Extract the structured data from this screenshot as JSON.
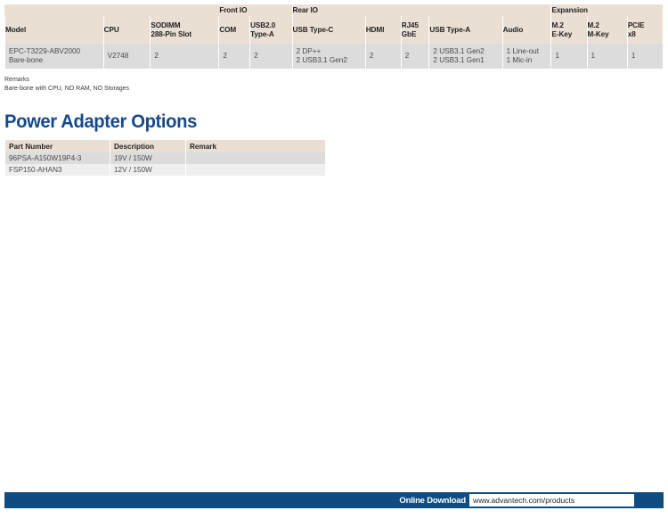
{
  "spec_table": {
    "groups": [
      {
        "label": "",
        "span": 3,
        "blank": true
      },
      {
        "label": "Front IO",
        "span": 2,
        "blank": false
      },
      {
        "label": "Rear IO",
        "span": 5,
        "blank": false
      },
      {
        "label": "Expansion",
        "span": 3,
        "blank": false
      }
    ],
    "columns": [
      {
        "label": "Model",
        "width": 105
      },
      {
        "label": "CPU",
        "width": 50
      },
      {
        "label": "SODIMM\n288-Pin Slot",
        "line1": "SODIMM",
        "line2": "288-Pin Slot",
        "width": 73
      },
      {
        "label": "COM",
        "width": 33
      },
      {
        "label": "USB2.0\nType-A",
        "line1": "USB2.0",
        "line2": "Type-A",
        "width": 45
      },
      {
        "label": "USB Type-C",
        "width": 78
      },
      {
        "label": "HDMI",
        "width": 38
      },
      {
        "label": "RJ45\nGbE",
        "line1": "RJ45",
        "line2": "GbE",
        "width": 30
      },
      {
        "label": "USB Type-A",
        "width": 78
      },
      {
        "label": "Audio",
        "width": 52
      },
      {
        "label": "M.2\nE-Key",
        "line1": "M.2",
        "line2": "E-Key",
        "width": 38
      },
      {
        "label": "M.2\nM-Key",
        "line1": "M.2",
        "line2": "M-Key",
        "width": 43
      },
      {
        "label": "PCIE\nx8",
        "line1": "PCIE",
        "line2": "x8",
        "width": 38
      }
    ],
    "rows": [
      {
        "model_line1": "EPC-T3229-ABV2000",
        "model_line2": "Bare-bone",
        "cpu": "V2748",
        "sodimm": "2",
        "com": "2",
        "usb20_type_a": "2",
        "usb_type_c_line1": "2 DP++",
        "usb_type_c_line2": "2 USB3.1 Gen2",
        "hdmi": "2",
        "rj45_gbe": "2",
        "usb_type_a_line1": "2 USB3.1 Gen2",
        "usb_type_a_line2": "2 USB3.1 Gen1",
        "audio_line1": "1 Line-out",
        "audio_line2": "1 Mic-in",
        "m2_ekey": "1",
        "m2_mkey": "1",
        "pcie_x8": "1"
      }
    ]
  },
  "remarks": {
    "title": "Remarks",
    "text": "Bare-bone with CPU, NO RAM, NO Storages"
  },
  "section": {
    "title": "Power Adapter Options"
  },
  "power_table": {
    "headers": {
      "part_number": "Part Number",
      "description": "Description",
      "remark": "Remark"
    },
    "rows": [
      {
        "part_number": "96PSA-A150W19P4-3",
        "description": "19V / 150W",
        "remark": ""
      },
      {
        "part_number": "FSP150-AHAN3",
        "description": "12V / 150W",
        "remark": ""
      }
    ]
  },
  "footer": {
    "label": "Online Download",
    "url": "www.advantech.com/products"
  },
  "colors": {
    "header_bg": "#e9e0d3",
    "row_bg": "#dcdcdc",
    "row_alt_bg": "#efefef",
    "accent_blue": "#154a8a",
    "footer_blue": "#0f4c81"
  }
}
